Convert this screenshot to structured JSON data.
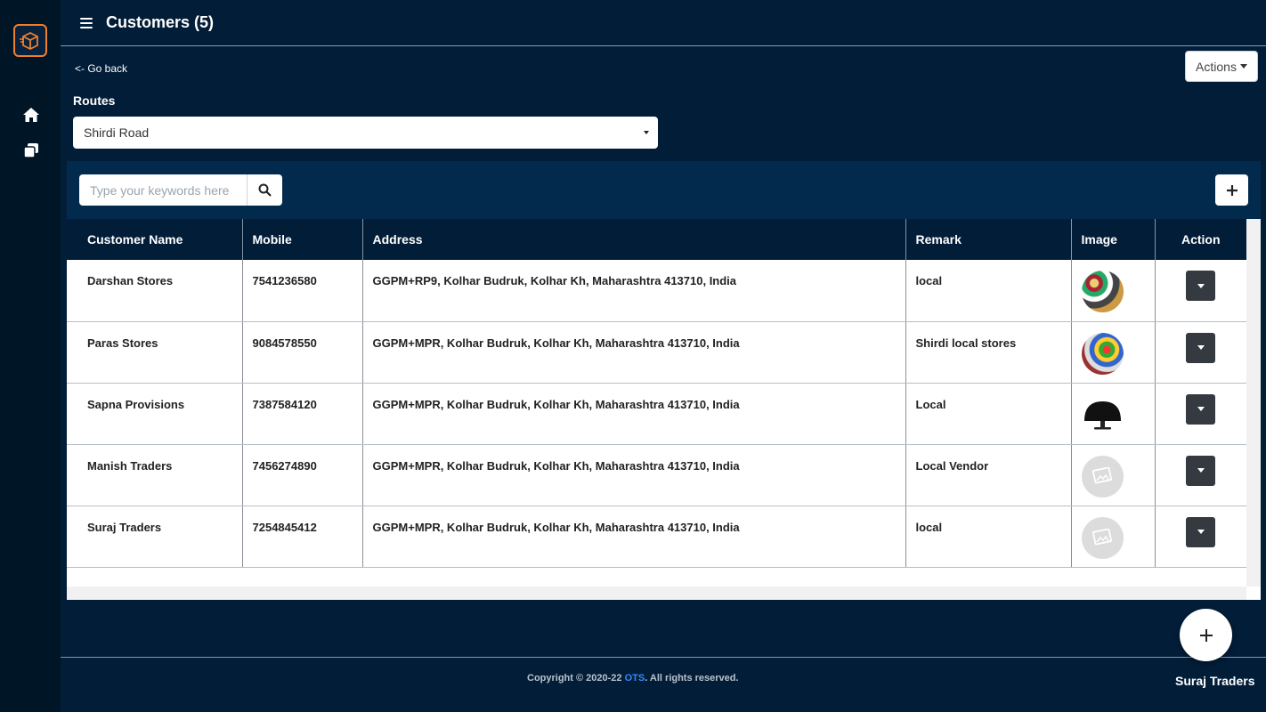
{
  "app": {
    "page_title": "Customers (5)",
    "company_name": "Suraj Traders"
  },
  "sidebar": {
    "items": [
      {
        "icon": "home-icon"
      },
      {
        "icon": "copy-icon"
      }
    ]
  },
  "nav": {
    "go_back": "<- Go back",
    "actions_label": "Actions"
  },
  "routes": {
    "label": "Routes",
    "selected": "Shirdi Road"
  },
  "search": {
    "placeholder": "Type your keywords here"
  },
  "table": {
    "headers": [
      "Customer Name",
      "Mobile",
      "Address",
      "Remark",
      "Image",
      "Action"
    ],
    "rows": [
      {
        "name": "Darshan Stores",
        "mobile": "7541236580",
        "address": "GGPM+RP9, Kolhar Budruk, Kolhar Kh, Maharashtra 413710, India",
        "remark": "local",
        "image": "store-photo"
      },
      {
        "name": "Paras Stores",
        "mobile": "9084578550",
        "address": "GGPM+MPR, Kolhar Budruk, Kolhar Kh, Maharashtra 413710, India",
        "remark": "Shirdi local stores",
        "image": "store-photo"
      },
      {
        "name": "Sapna Provisions",
        "mobile": "7387584120",
        "address": "GGPM+MPR, Kolhar Budruk, Kolhar Kh, Maharashtra 413710, India",
        "remark": "Local",
        "image": "monitor-photo"
      },
      {
        "name": "Manish Traders",
        "mobile": "7456274890",
        "address": "GGPM+MPR, Kolhar Budruk, Kolhar Kh, Maharashtra 413710, India",
        "remark": "Local Vendor",
        "image": "placeholder"
      },
      {
        "name": "Suraj Traders",
        "mobile": "7254845412",
        "address": "GGPM+MPR, Kolhar Budruk, Kolhar Kh, Maharashtra 413710, India",
        "remark": "local",
        "image": "placeholder"
      }
    ]
  },
  "footer": {
    "copyright_prefix": "Copyright © 2020-22 ",
    "brand": "OTS",
    "copyright_suffix": ". All rights reserved."
  },
  "colors": {
    "background": "#021d38",
    "sidebar": "#001526",
    "panel": "#012a4d",
    "accent": "#f07f2a",
    "brand_link": "#2d8cff"
  }
}
